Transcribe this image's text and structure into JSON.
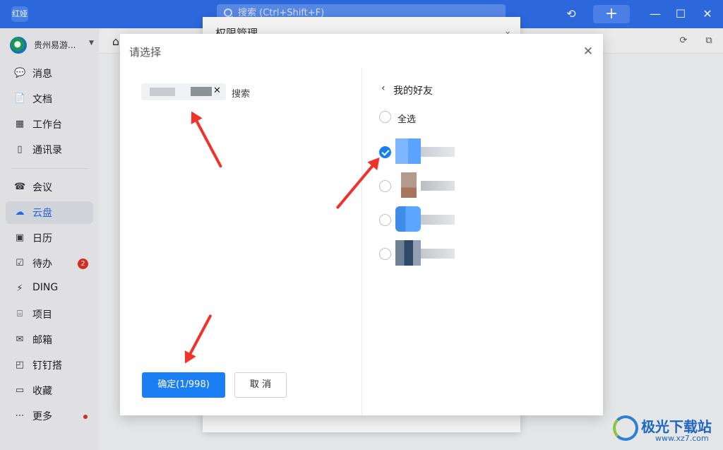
{
  "app": {
    "logo_text": "红娅"
  },
  "titlebar": {
    "search_placeholder": "搜索 (Ctrl+Shift+F)",
    "history_icon": "history-icon",
    "add_icon": "plus-icon",
    "minimize": "—",
    "maximize": "☐",
    "close": "✕"
  },
  "sidebar": {
    "workspace_name": "贵州易游...",
    "items": [
      {
        "label": "消息",
        "icon": "💬"
      },
      {
        "label": "文档",
        "icon": "📄"
      },
      {
        "label": "工作台",
        "icon": "▦"
      },
      {
        "label": "通讯录",
        "icon": "▯"
      },
      {
        "label": "会议",
        "icon": "☎"
      },
      {
        "label": "云盘",
        "icon": "☁"
      },
      {
        "label": "日历",
        "icon": "▣"
      },
      {
        "label": "待办",
        "icon": "☑",
        "badge": "2"
      },
      {
        "label": "DING",
        "icon": "⚡"
      },
      {
        "label": "项目",
        "icon": "⌸"
      },
      {
        "label": "邮箱",
        "icon": "✉"
      },
      {
        "label": "钉钉搭",
        "icon": "◰"
      },
      {
        "label": "收藏",
        "icon": "▭"
      },
      {
        "label": "更多",
        "icon": "⋯"
      }
    ],
    "active": "云盘"
  },
  "background_dialog": {
    "title": "权限管理"
  },
  "select_dialog": {
    "title": "请选择",
    "search_label": "搜索",
    "confirm_label": "确定(1/998)",
    "cancel_label": "取 消",
    "back_label": "我的好友",
    "select_all_label": "全选",
    "friends": [
      {
        "checked": true
      },
      {
        "checked": false
      },
      {
        "checked": false
      },
      {
        "checked": false
      }
    ]
  },
  "watermark": {
    "text": "极光下载站",
    "url": "www.xz7.com"
  },
  "colors": {
    "accent": "#1a7ef5",
    "titlebar": "#2f6de8",
    "annotation": "#f1322a"
  }
}
